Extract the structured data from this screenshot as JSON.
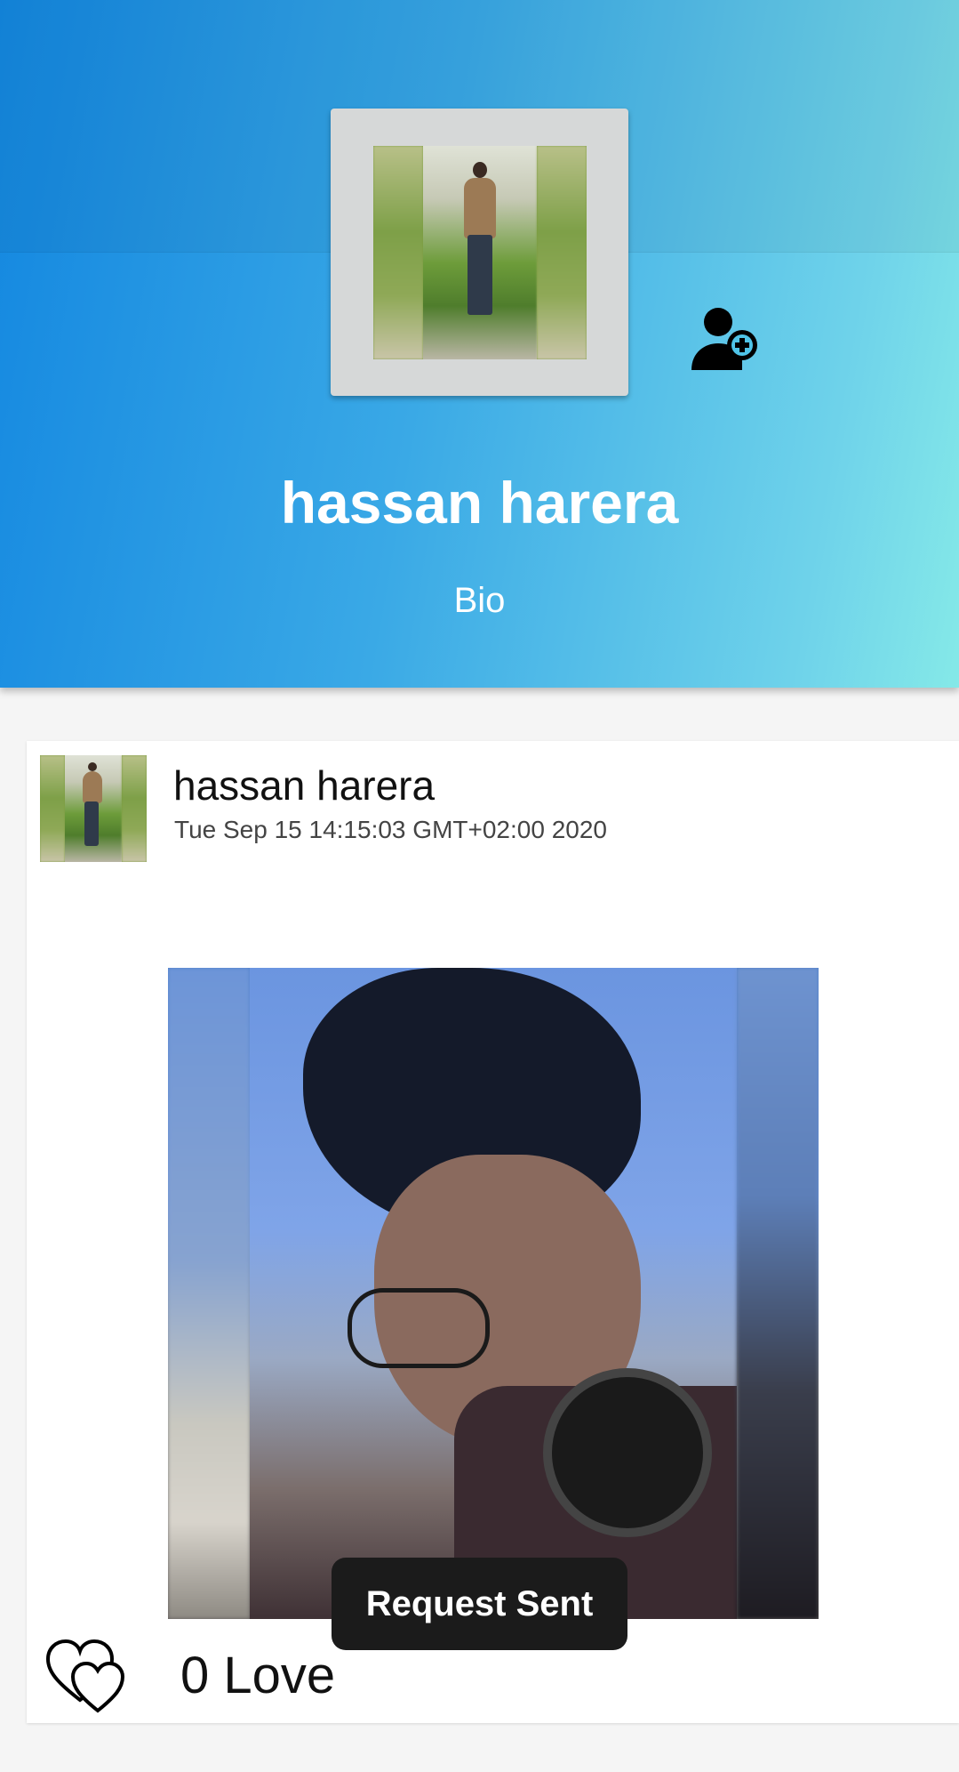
{
  "profile": {
    "name": "hassan harera",
    "bio": "Bio",
    "add_friend_icon": "person-add-icon"
  },
  "post": {
    "author": "hassan harera",
    "date": "Tue Sep 15 14:15:03 GMT+02:00 2020",
    "love_icon": "love-icon",
    "love_count": "0 Love"
  },
  "toast": {
    "message": "Request Sent"
  },
  "colors": {
    "header_gradient_start": "#1387e0",
    "header_gradient_end": "#85e9e8",
    "toast_background": "#1b1b1b"
  }
}
